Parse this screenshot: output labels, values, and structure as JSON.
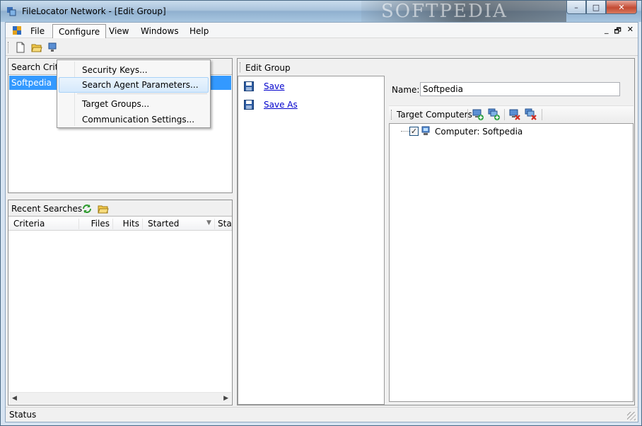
{
  "window": {
    "title": "FileLocator Network - [Edit Group]",
    "watermark": "SOFTPEDIA"
  },
  "caption_buttons": {
    "minimize": "–",
    "maximize": "□",
    "close": "✕"
  },
  "menu": {
    "items": [
      "File",
      "Configure",
      "View",
      "Windows",
      "Help"
    ],
    "open": "Configure",
    "mdi": {
      "minimize": "_",
      "restore": "🗗",
      "close": "✕"
    }
  },
  "configure_menu": [
    "Security Keys...",
    "Search Agent Parameters...",
    "Target Groups...",
    "Communication Settings..."
  ],
  "search_criteria": {
    "header": "Search Criteria",
    "rows": [
      "Softpedia"
    ]
  },
  "recent_searches": {
    "header": "Recent Searches",
    "columns": [
      "Criteria",
      "Files",
      "Hits",
      "Started",
      "Sta"
    ]
  },
  "edit_group": {
    "title": "Edit Group",
    "actions": [
      "Save",
      "Save As"
    ],
    "name_label": "Name:",
    "name_value": "Softpedia",
    "target_computers_label": "Target Computers",
    "tree": [
      {
        "label": "Computer: Softpedia",
        "checked": true
      }
    ]
  },
  "status": {
    "text": "Status"
  },
  "colors": {
    "selection": "#3399ff",
    "link": "#0000cc",
    "menu_hover": "#d6e9fc"
  }
}
